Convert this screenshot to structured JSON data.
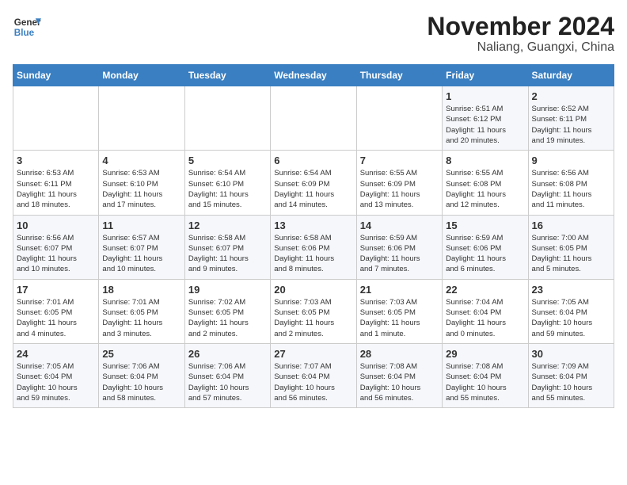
{
  "header": {
    "logo_line1": "General",
    "logo_line2": "Blue",
    "title": "November 2024",
    "subtitle": "Naliang, Guangxi, China"
  },
  "weekdays": [
    "Sunday",
    "Monday",
    "Tuesday",
    "Wednesday",
    "Thursday",
    "Friday",
    "Saturday"
  ],
  "weeks": [
    [
      {
        "day": "",
        "info": ""
      },
      {
        "day": "",
        "info": ""
      },
      {
        "day": "",
        "info": ""
      },
      {
        "day": "",
        "info": ""
      },
      {
        "day": "",
        "info": ""
      },
      {
        "day": "1",
        "info": "Sunrise: 6:51 AM\nSunset: 6:12 PM\nDaylight: 11 hours\nand 20 minutes."
      },
      {
        "day": "2",
        "info": "Sunrise: 6:52 AM\nSunset: 6:11 PM\nDaylight: 11 hours\nand 19 minutes."
      }
    ],
    [
      {
        "day": "3",
        "info": "Sunrise: 6:53 AM\nSunset: 6:11 PM\nDaylight: 11 hours\nand 18 minutes."
      },
      {
        "day": "4",
        "info": "Sunrise: 6:53 AM\nSunset: 6:10 PM\nDaylight: 11 hours\nand 17 minutes."
      },
      {
        "day": "5",
        "info": "Sunrise: 6:54 AM\nSunset: 6:10 PM\nDaylight: 11 hours\nand 15 minutes."
      },
      {
        "day": "6",
        "info": "Sunrise: 6:54 AM\nSunset: 6:09 PM\nDaylight: 11 hours\nand 14 minutes."
      },
      {
        "day": "7",
        "info": "Sunrise: 6:55 AM\nSunset: 6:09 PM\nDaylight: 11 hours\nand 13 minutes."
      },
      {
        "day": "8",
        "info": "Sunrise: 6:55 AM\nSunset: 6:08 PM\nDaylight: 11 hours\nand 12 minutes."
      },
      {
        "day": "9",
        "info": "Sunrise: 6:56 AM\nSunset: 6:08 PM\nDaylight: 11 hours\nand 11 minutes."
      }
    ],
    [
      {
        "day": "10",
        "info": "Sunrise: 6:56 AM\nSunset: 6:07 PM\nDaylight: 11 hours\nand 10 minutes."
      },
      {
        "day": "11",
        "info": "Sunrise: 6:57 AM\nSunset: 6:07 PM\nDaylight: 11 hours\nand 10 minutes."
      },
      {
        "day": "12",
        "info": "Sunrise: 6:58 AM\nSunset: 6:07 PM\nDaylight: 11 hours\nand 9 minutes."
      },
      {
        "day": "13",
        "info": "Sunrise: 6:58 AM\nSunset: 6:06 PM\nDaylight: 11 hours\nand 8 minutes."
      },
      {
        "day": "14",
        "info": "Sunrise: 6:59 AM\nSunset: 6:06 PM\nDaylight: 11 hours\nand 7 minutes."
      },
      {
        "day": "15",
        "info": "Sunrise: 6:59 AM\nSunset: 6:06 PM\nDaylight: 11 hours\nand 6 minutes."
      },
      {
        "day": "16",
        "info": "Sunrise: 7:00 AM\nSunset: 6:05 PM\nDaylight: 11 hours\nand 5 minutes."
      }
    ],
    [
      {
        "day": "17",
        "info": "Sunrise: 7:01 AM\nSunset: 6:05 PM\nDaylight: 11 hours\nand 4 minutes."
      },
      {
        "day": "18",
        "info": "Sunrise: 7:01 AM\nSunset: 6:05 PM\nDaylight: 11 hours\nand 3 minutes."
      },
      {
        "day": "19",
        "info": "Sunrise: 7:02 AM\nSunset: 6:05 PM\nDaylight: 11 hours\nand 2 minutes."
      },
      {
        "day": "20",
        "info": "Sunrise: 7:03 AM\nSunset: 6:05 PM\nDaylight: 11 hours\nand 2 minutes."
      },
      {
        "day": "21",
        "info": "Sunrise: 7:03 AM\nSunset: 6:05 PM\nDaylight: 11 hours\nand 1 minute."
      },
      {
        "day": "22",
        "info": "Sunrise: 7:04 AM\nSunset: 6:04 PM\nDaylight: 11 hours\nand 0 minutes."
      },
      {
        "day": "23",
        "info": "Sunrise: 7:05 AM\nSunset: 6:04 PM\nDaylight: 10 hours\nand 59 minutes."
      }
    ],
    [
      {
        "day": "24",
        "info": "Sunrise: 7:05 AM\nSunset: 6:04 PM\nDaylight: 10 hours\nand 59 minutes."
      },
      {
        "day": "25",
        "info": "Sunrise: 7:06 AM\nSunset: 6:04 PM\nDaylight: 10 hours\nand 58 minutes."
      },
      {
        "day": "26",
        "info": "Sunrise: 7:06 AM\nSunset: 6:04 PM\nDaylight: 10 hours\nand 57 minutes."
      },
      {
        "day": "27",
        "info": "Sunrise: 7:07 AM\nSunset: 6:04 PM\nDaylight: 10 hours\nand 56 minutes."
      },
      {
        "day": "28",
        "info": "Sunrise: 7:08 AM\nSunset: 6:04 PM\nDaylight: 10 hours\nand 56 minutes."
      },
      {
        "day": "29",
        "info": "Sunrise: 7:08 AM\nSunset: 6:04 PM\nDaylight: 10 hours\nand 55 minutes."
      },
      {
        "day": "30",
        "info": "Sunrise: 7:09 AM\nSunset: 6:04 PM\nDaylight: 10 hours\nand 55 minutes."
      }
    ]
  ]
}
